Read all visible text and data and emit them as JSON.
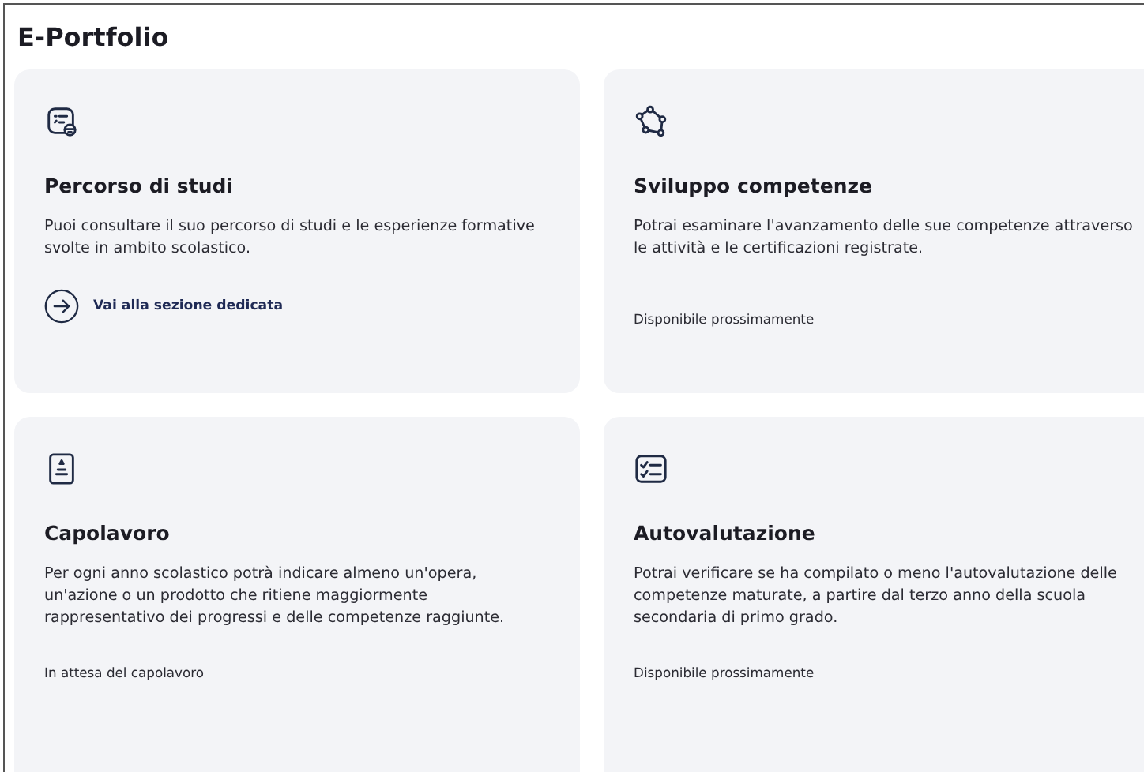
{
  "page": {
    "title": "E-Portfolio"
  },
  "cards": [
    {
      "title": "Percorso di studi",
      "description": "Puoi consultare il suo percorso di studi e le esperienze formative svolte in ambito scolastico.",
      "footer": {
        "kind": "link",
        "text": "Vai alla sezione dedicata"
      }
    },
    {
      "title": "Sviluppo competenze",
      "description": "Potrai esaminare l'avanzamento delle sue competenze attraverso le attività e le certificazioni registrate.",
      "footer": {
        "kind": "status",
        "text": "Disponibile prossimamente"
      }
    },
    {
      "title": "Capolavoro",
      "description": "Per ogni anno scolastico potrà indicare almeno un'opera, un'azione o un prodotto che ritiene maggiormente rappresentativo dei progressi e delle competenze raggiunte.",
      "footer": {
        "kind": "status",
        "text": "In attesa del capolavoro"
      }
    },
    {
      "title": "Autovalutazione",
      "description": "Potrai verificare se ha compilato o meno l'autovalutazione delle competenze maturate, a partire dal terzo anno della scuola secondaria di primo grado.",
      "footer": {
        "kind": "status",
        "text": "Disponibile prossimamente"
      }
    }
  ]
}
